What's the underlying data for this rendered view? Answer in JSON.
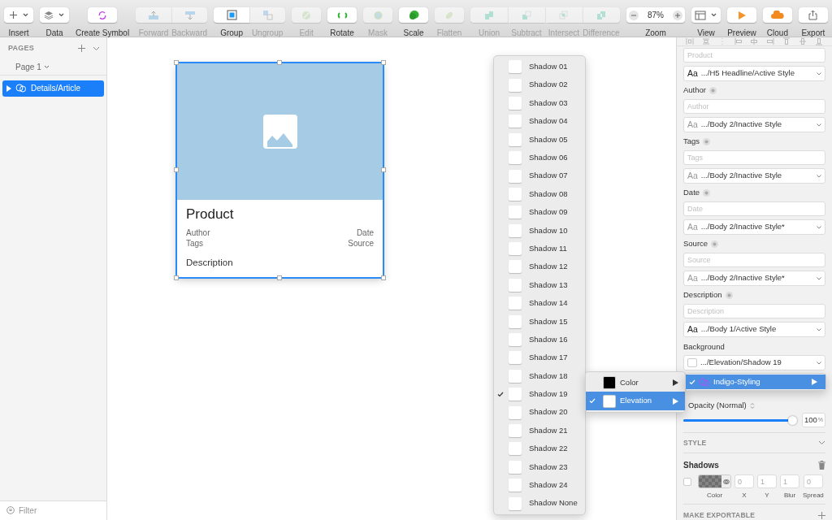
{
  "toolbar": {
    "groups": [
      {
        "items": [
          {
            "label": "Insert",
            "kind": "insert",
            "disabled": false
          }
        ]
      },
      {
        "items": [
          {
            "label": "Data",
            "kind": "data",
            "disabled": false
          }
        ]
      },
      {
        "items": [
          {
            "label": "Create Symbol",
            "kind": "symbol",
            "disabled": false
          }
        ]
      },
      {
        "items": [
          {
            "label": "Forward",
            "kind": "forward",
            "disabled": true
          },
          {
            "label": "Backward",
            "kind": "backward",
            "disabled": true
          }
        ]
      },
      {
        "items": [
          {
            "label": "Group",
            "kind": "group",
            "disabled": false
          },
          {
            "label": "Ungroup",
            "kind": "ungroup",
            "disabled": true
          }
        ]
      },
      {
        "items": [
          {
            "label": "Edit",
            "kind": "edit",
            "disabled": true
          }
        ]
      },
      {
        "items": [
          {
            "label": "Rotate",
            "kind": "rotate",
            "disabled": false
          }
        ]
      },
      {
        "items": [
          {
            "label": "Mask",
            "kind": "mask",
            "disabled": true
          }
        ]
      },
      {
        "items": [
          {
            "label": "Scale",
            "kind": "scale",
            "disabled": false
          }
        ]
      },
      {
        "items": [
          {
            "label": "Flatten",
            "kind": "flatten",
            "disabled": true
          }
        ]
      },
      {
        "items": [
          {
            "label": "Union",
            "kind": "union",
            "disabled": true
          },
          {
            "label": "Subtract",
            "kind": "subtract",
            "disabled": true
          },
          {
            "label": "Intersect",
            "kind": "intersect",
            "disabled": true
          },
          {
            "label": "Difference",
            "kind": "difference",
            "disabled": true
          }
        ]
      },
      {
        "items": [
          {
            "label": "Zoom",
            "kind": "zoom",
            "value": "87%",
            "disabled": false
          }
        ]
      },
      {
        "items": [
          {
            "label": "View",
            "kind": "view",
            "disabled": false
          }
        ]
      },
      {
        "items": [
          {
            "label": "Preview",
            "kind": "preview",
            "disabled": false
          }
        ]
      },
      {
        "items": [
          {
            "label": "Cloud",
            "kind": "cloud",
            "disabled": false
          }
        ]
      },
      {
        "items": [
          {
            "label": "Export",
            "kind": "export",
            "disabled": false
          }
        ]
      }
    ]
  },
  "sidebar": {
    "header": "PAGES",
    "page": "Page 1",
    "layers": [
      {
        "name": "Details/Article",
        "selected": true,
        "expanded": false
      }
    ],
    "filter": {
      "placeholder": "Filter"
    }
  },
  "canvas": {
    "card": {
      "title": "Product",
      "rows": [
        {
          "left": "Author",
          "right": "Date"
        },
        {
          "left": "Tags",
          "right": "Source"
        }
      ],
      "description": "Description",
      "selected": true
    }
  },
  "shadow_menu": {
    "items": [
      {
        "label": "Shadow 01",
        "checked": false
      },
      {
        "label": "Shadow 02",
        "checked": false
      },
      {
        "label": "Shadow 03",
        "checked": false
      },
      {
        "label": "Shadow 04",
        "checked": false
      },
      {
        "label": "Shadow 05",
        "checked": false
      },
      {
        "label": "Shadow 06",
        "checked": false
      },
      {
        "label": "Shadow 07",
        "checked": false
      },
      {
        "label": "Shadow 08",
        "checked": false
      },
      {
        "label": "Shadow 09",
        "checked": false
      },
      {
        "label": "Shadow 10",
        "checked": false
      },
      {
        "label": "Shadow 11",
        "checked": false
      },
      {
        "label": "Shadow 12",
        "checked": false
      },
      {
        "label": "Shadow 13",
        "checked": false
      },
      {
        "label": "Shadow 14",
        "checked": false
      },
      {
        "label": "Shadow 15",
        "checked": false
      },
      {
        "label": "Shadow 16",
        "checked": false
      },
      {
        "label": "Shadow 17",
        "checked": false
      },
      {
        "label": "Shadow 18",
        "checked": false
      },
      {
        "label": "Shadow 19",
        "checked": true
      },
      {
        "label": "Shadow 20",
        "checked": false
      },
      {
        "label": "Shadow 21",
        "checked": false
      },
      {
        "label": "Shadow 22",
        "checked": false
      },
      {
        "label": "Shadow 23",
        "checked": false
      },
      {
        "label": "Shadow 24",
        "checked": false
      },
      {
        "label": "Shadow None",
        "checked": false
      }
    ]
  },
  "group_menu": {
    "items": [
      {
        "label": "Color",
        "color": "#000000",
        "checked": false,
        "selected": false
      },
      {
        "label": "Elevation",
        "color": "#ffffff",
        "checked": true,
        "selected": true
      }
    ]
  },
  "library_menu": {
    "items": [
      {
        "label": "Indigo-Styling",
        "checked": true,
        "selected": true
      }
    ]
  },
  "inspector": {
    "overrides": [
      {
        "placeholder": "Product",
        "style": "Aa",
        "style_name": ".../H5 Headline/Active Style",
        "active": true
      },
      {
        "label": "Author",
        "placeholder": "Author",
        "style": "Aa",
        "style_name": ".../Body 2/Inactive Style",
        "active": false
      },
      {
        "label": "Tags",
        "placeholder": "Tags",
        "style": "Aa",
        "style_name": ".../Body 2/Inactive Style",
        "active": false
      },
      {
        "label": "Date",
        "placeholder": "Date",
        "style": "Aa",
        "style_name": ".../Body 2/Inactive Style*",
        "active": false
      },
      {
        "label": "Source",
        "placeholder": "Source",
        "style": "Aa",
        "style_name": ".../Body 2/Inactive Style*",
        "active": false
      },
      {
        "label": "Description",
        "placeholder": "Description",
        "style": "Aa",
        "style_name": ".../Body 1/Active Style",
        "active": true
      }
    ],
    "background": {
      "label": "Background",
      "value": ".../Elevation/Shadow 19"
    },
    "opacity": {
      "label": "Opacity (Normal)",
      "level": 1,
      "value": "100",
      "unit": "%"
    },
    "style_header": "STYLE",
    "shadows": {
      "title": "Shadows",
      "enabled": false,
      "color_label": "Color",
      "fields": [
        {
          "label": "X",
          "value": "0"
        },
        {
          "label": "Y",
          "value": "1"
        },
        {
          "label": "Blur",
          "value": "1"
        },
        {
          "label": "Spread",
          "value": "0"
        }
      ]
    },
    "export_header": "MAKE EXPORTABLE"
  }
}
